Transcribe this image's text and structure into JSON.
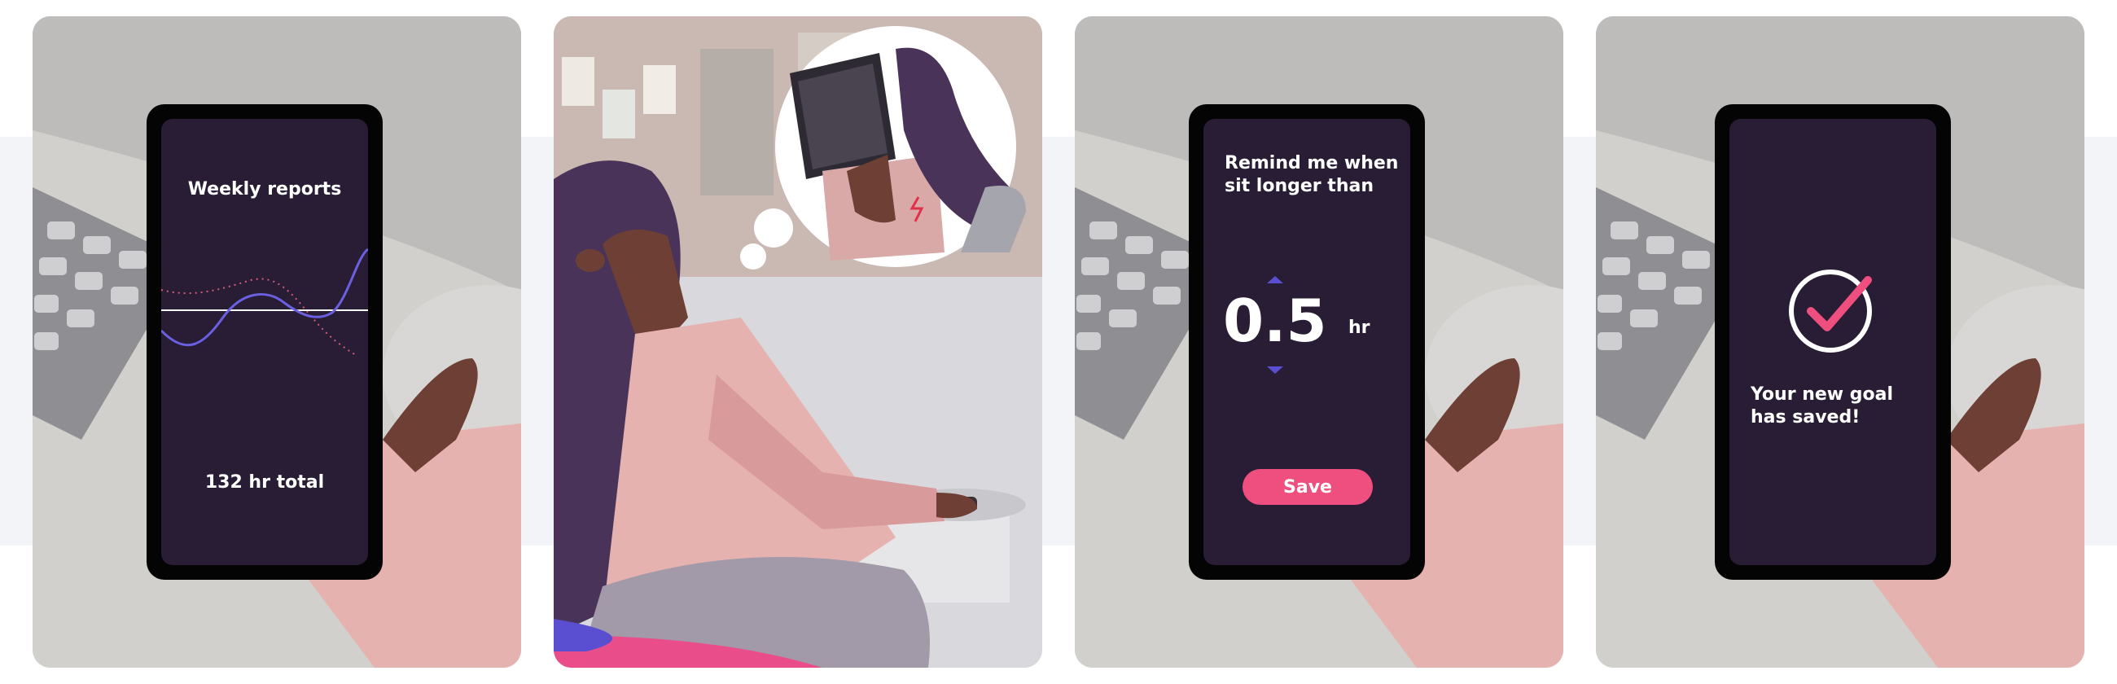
{
  "cards": [
    {
      "screen": {
        "title": "Weekly reports",
        "total": "132 hr total"
      }
    },
    {
      "illustration": "thinking-woman-sitting"
    },
    {
      "screen": {
        "prompt_line1": "Remind me when",
        "prompt_line2": "sit longer than",
        "value": "0.5",
        "unit": "hr",
        "save_label": "Save"
      }
    },
    {
      "screen": {
        "message_line1": "Your new goal",
        "message_line2": "has saved!"
      }
    }
  ],
  "colors": {
    "screen_bg": "#281d35",
    "accent_pink": "#ef4f7f",
    "accent_blue": "#5a4fd0",
    "hair": "#4a3358",
    "skin": "#6e3f34",
    "sleeve": "#e6b2b0"
  }
}
